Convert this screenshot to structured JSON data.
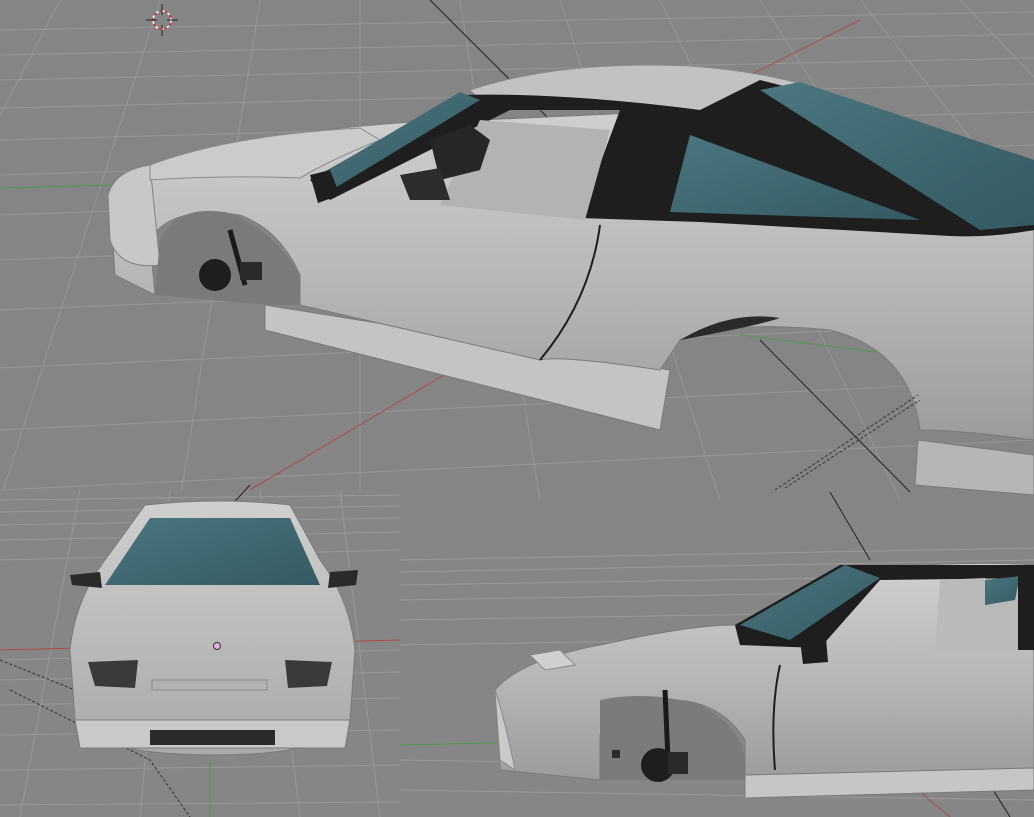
{
  "scene": {
    "background": "#858585",
    "grid_color": "#9a9a9a",
    "axis_x_color": "#b04848",
    "axis_y_color": "#4a9a4a",
    "body_color": "#bdbdbd",
    "body_shadow": "#8e8e8e",
    "body_highlight": "#d8d8d8",
    "glass_color": "#3f6670",
    "trim_color": "#1c1c1c"
  },
  "icons": {
    "cursor": "3d-cursor-icon",
    "origin": "object-origin-icon"
  },
  "views": [
    {
      "name": "perspective-view"
    },
    {
      "name": "front-view"
    },
    {
      "name": "side-view"
    }
  ]
}
